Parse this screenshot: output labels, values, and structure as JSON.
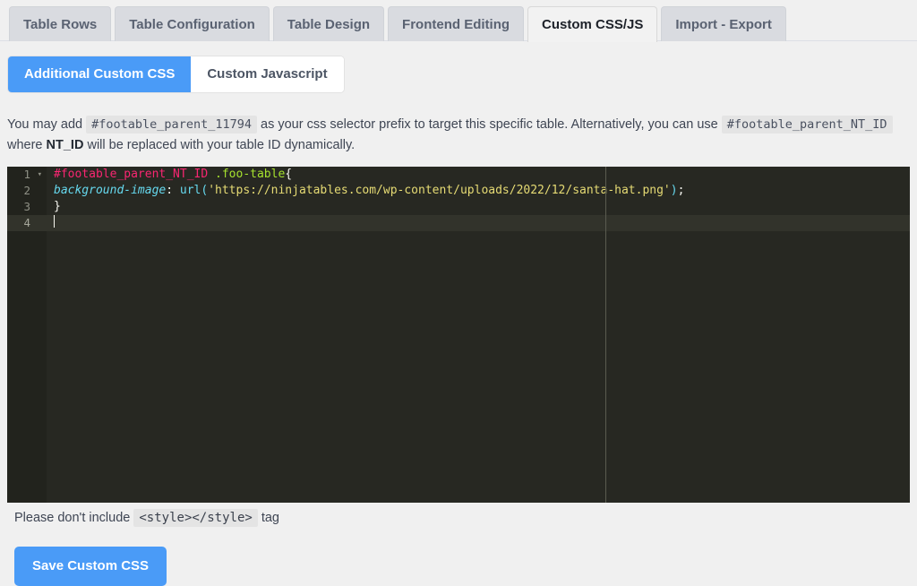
{
  "tabs": [
    {
      "label": "Table Rows",
      "active": false
    },
    {
      "label": "Table Configuration",
      "active": false
    },
    {
      "label": "Table Design",
      "active": false
    },
    {
      "label": "Frontend Editing",
      "active": false
    },
    {
      "label": "Custom CSS/JS",
      "active": true
    },
    {
      "label": "Import - Export",
      "active": false
    }
  ],
  "subtabs": [
    {
      "label": "Additional Custom CSS",
      "active": true
    },
    {
      "label": "Custom Javascript",
      "active": false
    }
  ],
  "description": {
    "part1": "You may add",
    "chip1": "#footable_parent_11794",
    "part2": "as your css selector prefix to target this specific table. Alternatively, you can use",
    "chip2": "#footable_parent_NT_ID",
    "part3": "where",
    "bold1": "NT_ID",
    "part4": "will be replaced with your table ID dynamically."
  },
  "editor": {
    "language": "css",
    "line_numbers": [
      "1",
      "2",
      "3",
      "4"
    ],
    "active_line": "4",
    "fold_marker": "▾",
    "ruler_column": "80",
    "lines": {
      "l1_selector": "#footable_parent_NT_ID",
      "l1_class": " .foo-table",
      "l1_brace": "{",
      "l2_property": "background-image",
      "l2_colon": ": ",
      "l2_fn_open": "url(",
      "l2_string": "'https://ninjatables.com/wp-content/uploads/2022/12/santa-hat.png'",
      "l2_fn_close": ")",
      "l2_semicolon": ";",
      "l3_brace": "}",
      "l4": ""
    },
    "colors": {
      "background": "#272822",
      "gutter": "#22231d",
      "active_line": "#32332b",
      "selector": "#f92672",
      "class": "#a6e22e",
      "property": "#66d9ef",
      "string": "#e6db74",
      "punctuation": "#f8f8f2",
      "line_number": "#8f9085",
      "ruler": "#5a5c50"
    }
  },
  "note": {
    "prefix": "Please don't include",
    "chip": "<style></style>",
    "suffix": "tag"
  },
  "save": {
    "label": "Save Custom CSS",
    "color": "#4a9bf7"
  }
}
